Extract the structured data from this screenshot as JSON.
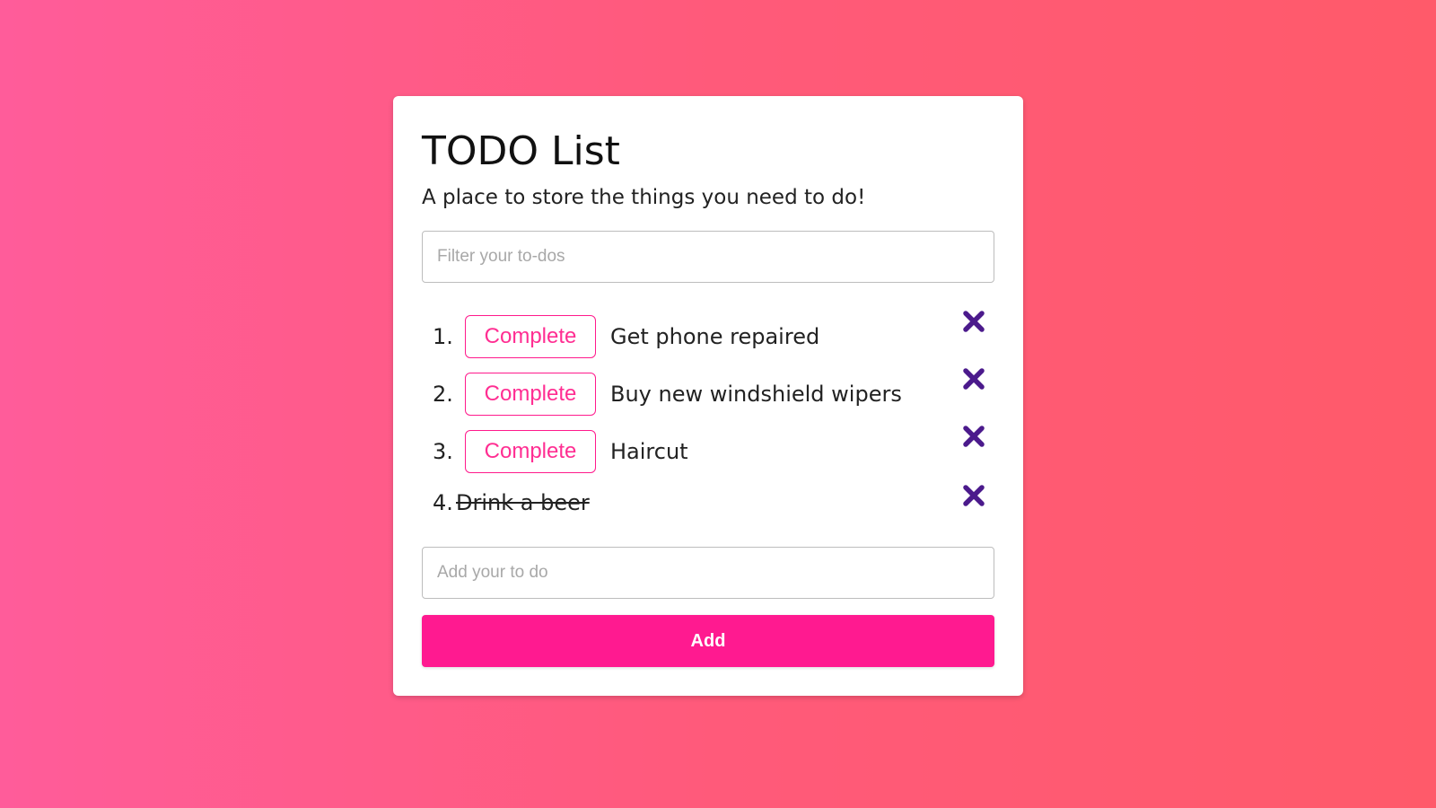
{
  "app": {
    "title": "TODO List",
    "subtitle": "A place to store the things you need to do!"
  },
  "filter": {
    "placeholder": "Filter your to-dos",
    "value": ""
  },
  "todos": [
    {
      "number": "1.",
      "text": "Get phone repaired",
      "completed": false,
      "complete_label": "Complete",
      "delete_icon": "close-icon"
    },
    {
      "number": "2.",
      "text": "Buy new windshield wipers",
      "completed": false,
      "complete_label": "Complete",
      "delete_icon": "close-icon"
    },
    {
      "number": "3.",
      "text": "Haircut",
      "completed": false,
      "complete_label": "Complete",
      "delete_icon": "close-icon"
    },
    {
      "number": "4.",
      "text": "Drink a beer",
      "completed": true,
      "delete_icon": "close-icon"
    }
  ],
  "add_form": {
    "placeholder": "Add your to do",
    "value": "",
    "button_label": "Add"
  },
  "colors": {
    "accent": "#ff1a90",
    "delete_icon": "#4b1a8c",
    "background_start": "#ff5c9a",
    "background_end": "#ff5a6a"
  }
}
